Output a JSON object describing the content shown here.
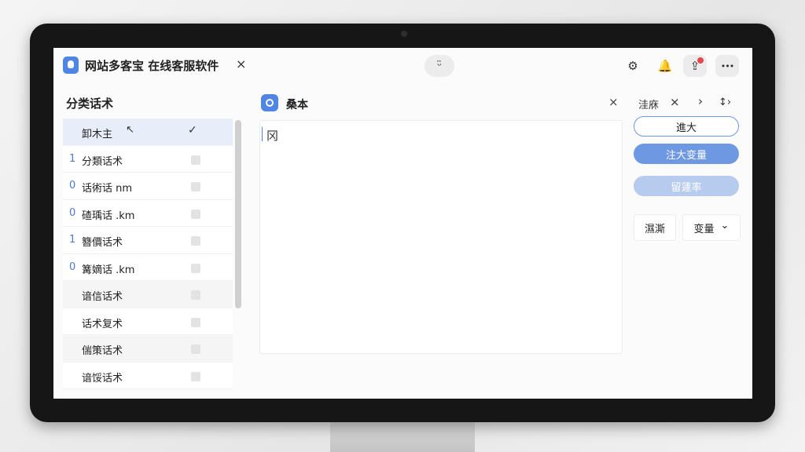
{
  "app": {
    "title": "网站多客宝 在线客服软件",
    "close_glyph": "×",
    "center_logo_glyph": "ᵕ̈"
  },
  "toolbar": {
    "settings_glyph": "⚙",
    "bell_glyph": "🔔",
    "share_glyph": "⇪",
    "more_glyph": "•••"
  },
  "left": {
    "title": "分类话术",
    "rows": [
      {
        "num": "",
        "label": "卸木主",
        "selected": true
      },
      {
        "num": "1",
        "label": "分類话术"
      },
      {
        "num": "0",
        "label": "话術话 nm"
      },
      {
        "num": "0",
        "label": "碴瑀话 .km"
      },
      {
        "num": "1",
        "label": "簪價话术"
      },
      {
        "num": "0",
        "label": "篝嫡话 .km"
      },
      {
        "num": "",
        "label": "谙信话术"
      },
      {
        "num": "",
        "label": "话术复术"
      },
      {
        "num": "",
        "label": "偳策话术"
      },
      {
        "num": "",
        "label": "谙馁话术"
      }
    ],
    "tick_glyph": "✓",
    "cursor_glyph": "↖"
  },
  "middle": {
    "title": "桑本",
    "close_glyph": "×",
    "editor_text": "冈"
  },
  "right": {
    "head_label": "洼庥",
    "head_close": "×",
    "head_chevron": "›",
    "head_swap": "↕›",
    "btn_outline": "進大",
    "btn_primary": "注大变量",
    "btn_disabled": "留蘧率",
    "btn_small_1": "濕澌",
    "btn_small_2": "变量",
    "chevron_down": "⌄"
  },
  "colors": {
    "accent": "#4f86e4",
    "primary_button": "#6e98e2",
    "disabled_button": "#b6cbee",
    "selected_row": "#e7eef9",
    "notification_dot": "#e5484d"
  }
}
